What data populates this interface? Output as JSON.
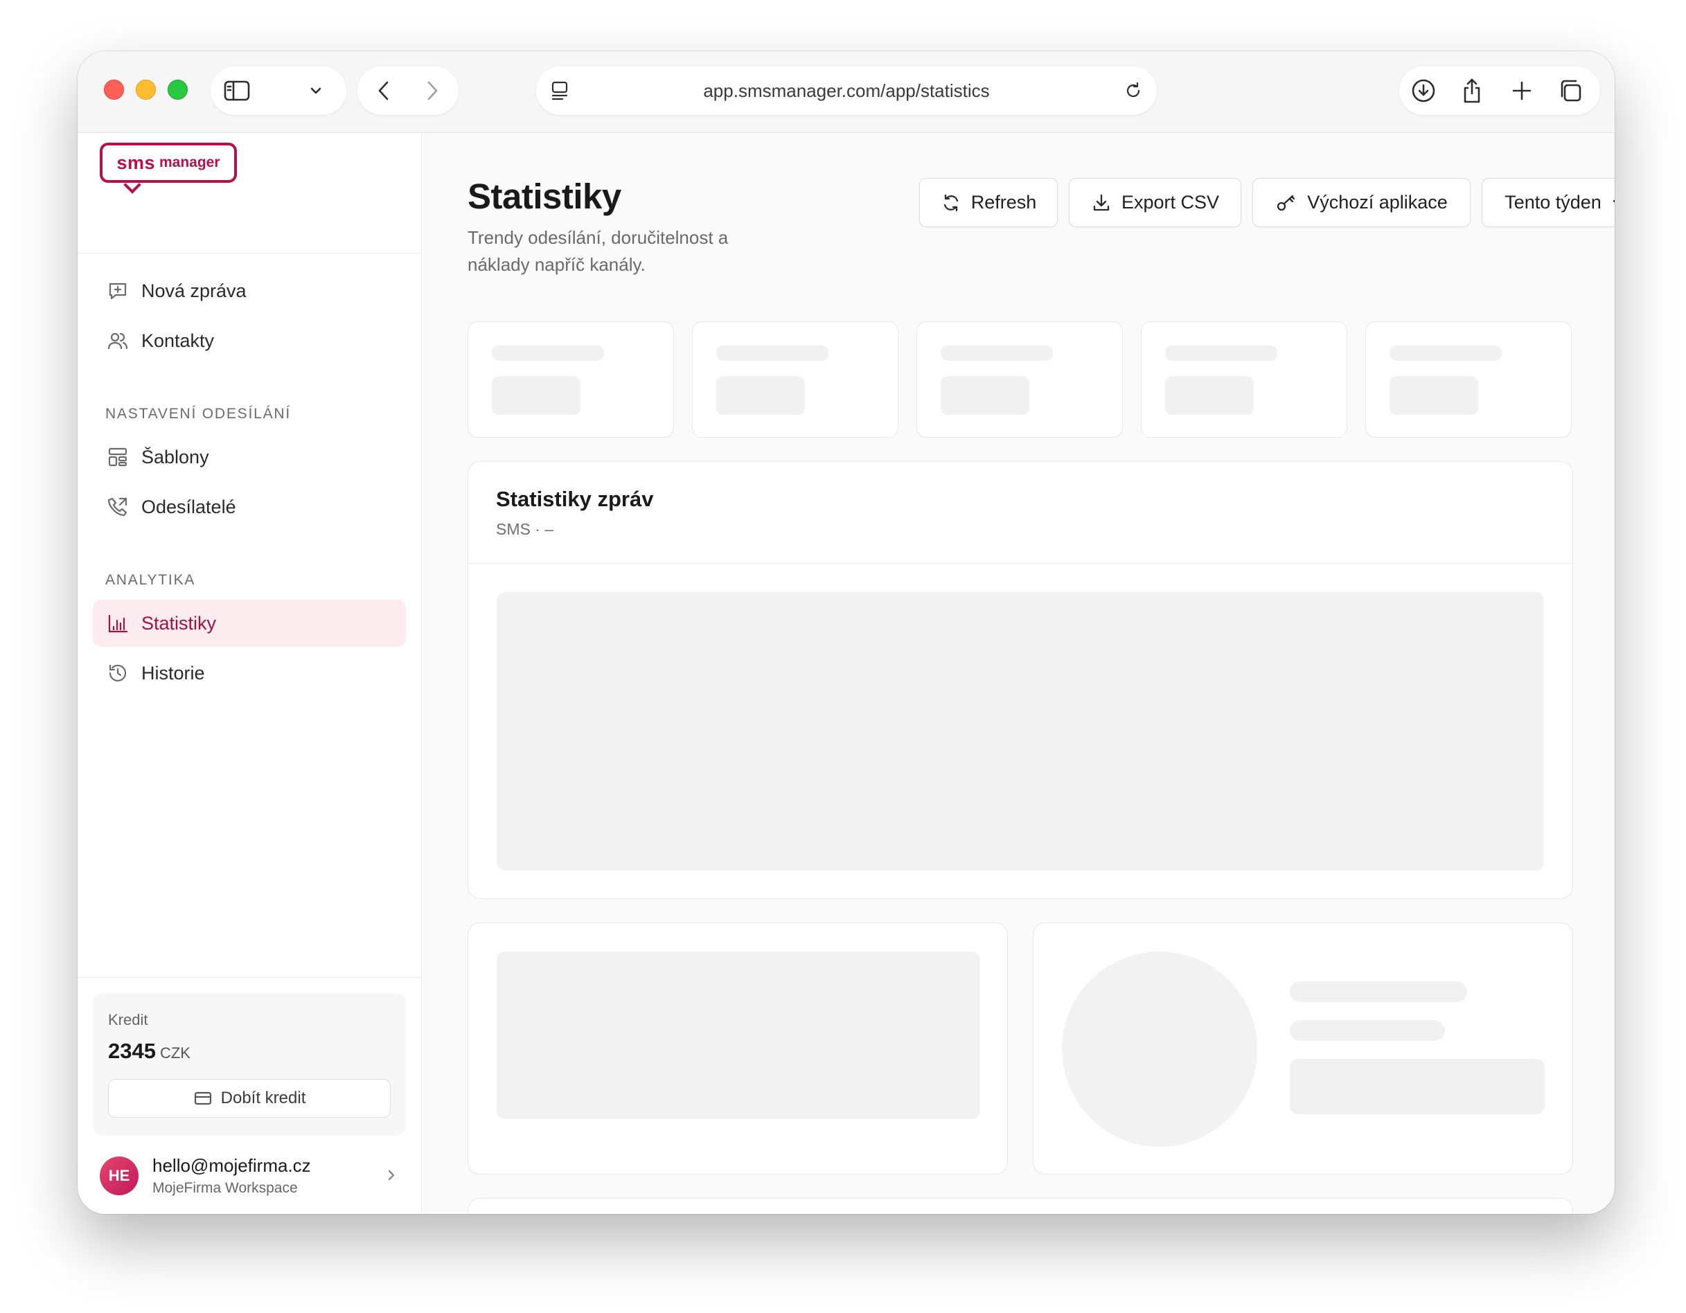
{
  "browser": {
    "url": "app.smsmanager.com/app/statistics"
  },
  "sidebar": {
    "logo": {
      "primary": "sms",
      "secondary": "manager"
    },
    "items_top": [
      {
        "label": "Nová zpráva",
        "icon": "message-plus-icon"
      },
      {
        "label": "Kontakty",
        "icon": "users-icon"
      }
    ],
    "section_sending": "NASTAVENÍ ODESÍLÁNÍ",
    "items_sending": [
      {
        "label": "Šablony",
        "icon": "template-icon"
      },
      {
        "label": "Odesílatelé",
        "icon": "phone-icon"
      }
    ],
    "section_analytics": "ANALYTIKA",
    "items_analytics": [
      {
        "label": "Statistiky",
        "icon": "bar-chart-icon",
        "active": true
      },
      {
        "label": "Historie",
        "icon": "history-icon"
      }
    ],
    "credit": {
      "label": "Kredit",
      "amount": "2345",
      "currency": "CZK",
      "topup_label": "Dobít kredit"
    },
    "user": {
      "initials": "HE",
      "email": "hello@mojefirma.cz",
      "workspace": "MojeFirma Workspace"
    }
  },
  "main": {
    "title": "Statistiky",
    "subtitle": "Trendy odesílání, doručitelnost a náklady napříč kanály.",
    "buttons": {
      "refresh": "Refresh",
      "export": "Export CSV",
      "app": "Výchozí aplikace",
      "range": "Tento týden"
    },
    "message_panel": {
      "title": "Statistiky zpráv",
      "subtitle": "SMS · –"
    }
  },
  "colors": {
    "accent": "#a3123f",
    "accent_bg": "#fdecef",
    "skeleton": "#f1f1f1"
  }
}
